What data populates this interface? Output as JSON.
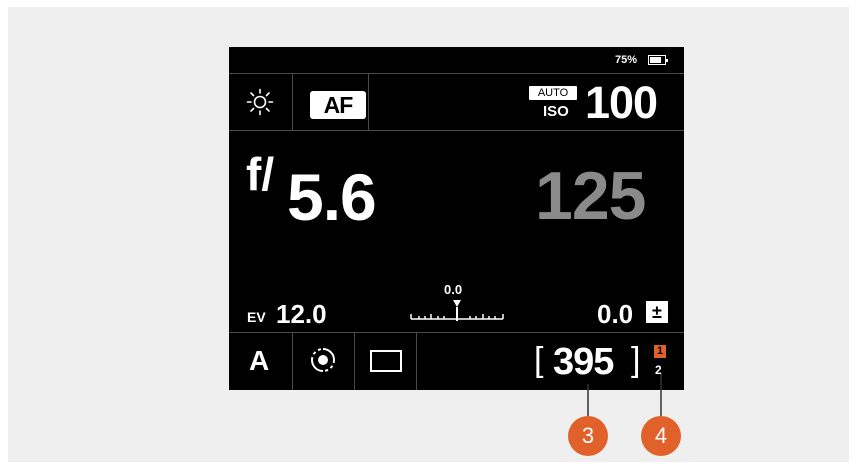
{
  "status": {
    "battery_percent": "75%"
  },
  "top_row": {
    "white_balance_icon": "sun-icon",
    "af_label": "AF",
    "iso_auto_label": "AUTO",
    "iso_label": "ISO",
    "iso_value": "100"
  },
  "exposure": {
    "f_prefix": "f/",
    "aperture": "5.6",
    "shutter": "125"
  },
  "meter_row": {
    "ev_label": "EV",
    "ev_value": "12.0",
    "meter_value": "0.0",
    "exposure_comp": "0.0",
    "comp_icon_text": "±"
  },
  "bottom_row": {
    "mode": "A",
    "focus_icon": "focus-point-icon",
    "frame_icon": "single-frame-icon",
    "bracket_left": "[",
    "shots_remaining": "395",
    "bracket_right": "]",
    "card_slot_active": "1",
    "card_slot_other": "2"
  },
  "callouts": [
    {
      "number": "3"
    },
    {
      "number": "4"
    }
  ],
  "colors": {
    "screen_bg": "#000000",
    "panel_bg": "#efefef",
    "callout": "#e0622a",
    "shutter_grey": "#8a8a8a"
  }
}
